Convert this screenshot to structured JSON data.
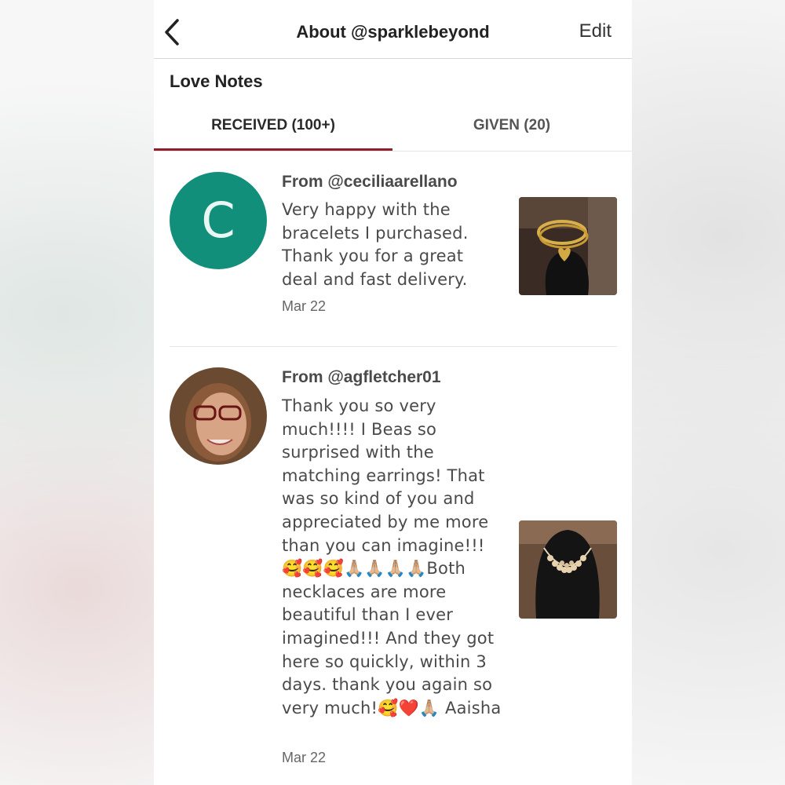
{
  "header": {
    "title": "About @sparklebeyond",
    "edit_label": "Edit"
  },
  "section_title": "Love Notes",
  "tabs": [
    {
      "label": "RECEIVED (100+)",
      "active": true
    },
    {
      "label": "GIVEN (20)",
      "active": false
    }
  ],
  "notes": [
    {
      "avatar_letter": "C",
      "from": "From @ceciliaarellano",
      "message": "Very happy with the bracelets I purchased. Thank you for a great deal and fast delivery.",
      "date": "Mar 22",
      "thumbnail_icon": "bracelet-photo"
    },
    {
      "from": "From @agfletcher01",
      "message": "Thank you so very much!!!! I Beas so surprised with the matching earrings! That was so kind of you and appreciated by me more than you can imagine!!! 🥰🥰🥰🙏🏼🙏🏼🙏🏼🙏🏼Both necklaces are more beautiful than I ever imagined!!! And they got here so quickly, within 3 days. thank you again so very much!🥰❤️🙏🏼 Aaisha",
      "date": "Mar 22",
      "thumbnail_icon": "necklace-photo"
    }
  ],
  "colors": {
    "accent": "#8e1f2b",
    "avatar_teal": "#128f7b"
  }
}
